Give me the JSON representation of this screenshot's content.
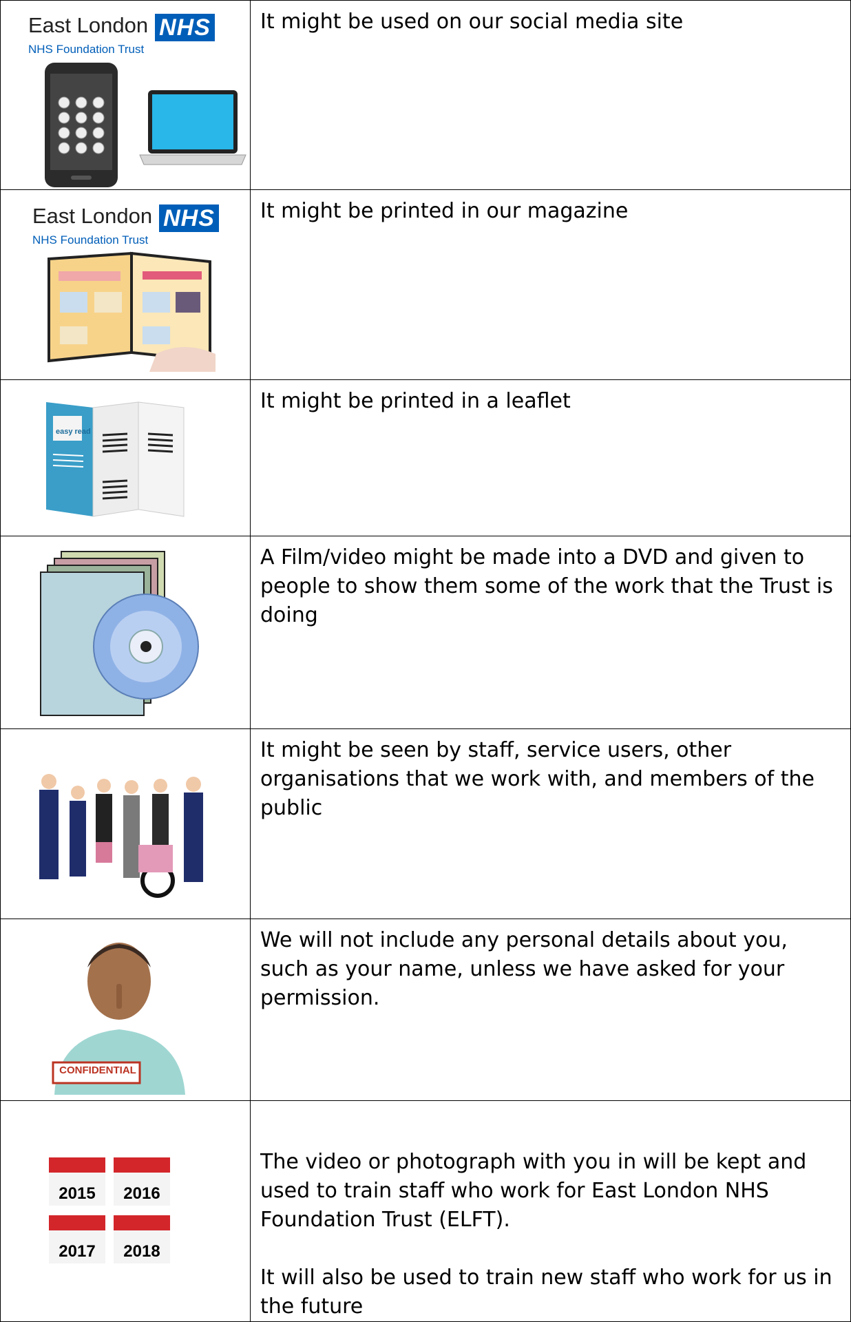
{
  "logo": {
    "org": "East London",
    "nhs": "NHS",
    "sub": "NHS Foundation Trust"
  },
  "rows": [
    {
      "text": "It might be used on our social media site"
    },
    {
      "text": "It might be printed in our magazine"
    },
    {
      "text": "It might be printed in a leaflet"
    },
    {
      "text": "A Film/video might be made into a DVD and given to people to show them some of the work that the Trust is doing"
    },
    {
      "text": "It might be seen by staff, service users, other organisations that we work with, and members of the public"
    },
    {
      "text": "We will not include any personal details about you, such as your name, unless we have asked for your permission."
    },
    {
      "text": "The video or photograph with you in will be kept and used to train staff who work for East London NHS Foundation Trust (ELFT).",
      "text2": "It will also be used to train new staff who work for us in the future"
    }
  ],
  "leaflet_badge": "easy read",
  "stamp": "CONFIDENTIAL",
  "years": [
    "2015",
    "2016",
    "2017",
    "2018"
  ],
  "colors": {
    "nhs_blue": "#005eb8",
    "calendar_red": "#d3262b",
    "leaflet_blue": "#3a9ec8"
  }
}
